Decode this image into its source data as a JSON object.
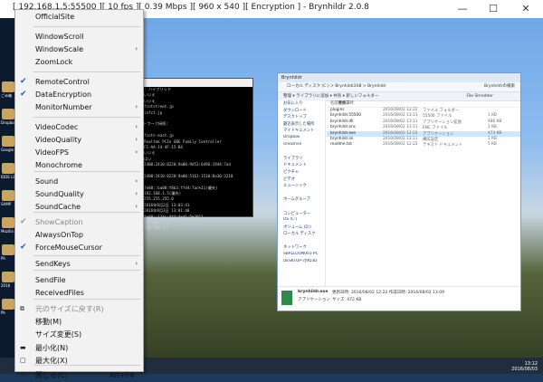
{
  "window": {
    "title": "[ 192.168.1.5:55500 ][ 10 fps ][ 0.39 Mbps ][ 960 x 540 ][ Encryption ] - Brynhildr 2.0.8",
    "minimize_glyph": "—",
    "maximize_glyph": "☐",
    "close_glyph": "✕"
  },
  "menu": {
    "items": [
      {
        "label": "OfficialSite"
      },
      {
        "label": "WindowScroll"
      },
      {
        "label": "WindowScale",
        "submenu": true
      },
      {
        "label": "ZoomLock"
      },
      {
        "label": "RemoteControl",
        "checked": true
      },
      {
        "label": "DataEncryption",
        "checked": true
      },
      {
        "label": "MonitorNumber",
        "submenu": true
      },
      {
        "label": "VideoCodec",
        "submenu": true
      },
      {
        "label": "VideoQuality",
        "submenu": true
      },
      {
        "label": "VideoFPS",
        "submenu": true
      },
      {
        "label": "Monochrome"
      },
      {
        "label": "Sound",
        "submenu": true
      },
      {
        "label": "SoundQuality",
        "submenu": true
      },
      {
        "label": "SoundCache",
        "submenu": true
      },
      {
        "label": "ShowCaption",
        "checked": true,
        "disabled": true
      },
      {
        "label": "AlwaysOnTop"
      },
      {
        "label": "ForceMouseCursor",
        "checked": true
      },
      {
        "label": "SendKeys",
        "submenu": true
      },
      {
        "label": "SendFile"
      },
      {
        "label": "ReceivedFiles"
      },
      {
        "label": "元のサイズに戻す(R)",
        "disabled": true,
        "icon": "restore-icon"
      },
      {
        "label": "移動(M)"
      },
      {
        "label": "サイズ変更(S)"
      },
      {
        "label": "最小化(N)",
        "icon": "minimize-icon"
      },
      {
        "label": "最大化(X)",
        "icon": "maximize-icon"
      },
      {
        "label": "閉じる(C)",
        "shortcut": "Alt+F4",
        "icon": "close-icon"
      }
    ],
    "arrow_glyph": "›",
    "check_glyph": "✔"
  },
  "remote": {
    "console_lines": [
      "   :  : ハイブリッド",
      "   : いいえ",
      "   : いいえ",
      "   : fintstreet.jp",
      "   : infct.jp",
      "",
      "ートワーク接続:",
      "",
      "   : fints-east.jp",
      "   : Realtek PCIe GBE Family Controller",
      "   : FC-AA-14-4F-15-B4",
      "   : いいえ",
      "   : はい",
      "   : 2400:2410:8220:9a00:9d51:6496:1944:7ad",
      "",
      "   : 2400:2410:8220:9a00:5161:1510:0a30:3210",
      "",
      "   : fe80::ba08:f8b3:ffd4:7ac%11(優先)",
      "   : 192.168.1.5(優先)",
      "   : 255.255.255.0",
      "   : 2016年8月2日 13:03:41",
      "   : 2016年8月3日 13:01:40",
      "   : fe80::124c:4ff:fe41:5%2011",
      "   : 192.168.1.1",
      "   : 192.168.1.1"
    ],
    "explorer": {
      "title": "Brynhildr",
      "address": "ローカル ディスク (C:) > Brynhildr208 > Brynhildr",
      "search": "Brynhildrの検索",
      "toolbar": "整理 ▾   ライブラリに追加 ▾   共有 ▾   新しいフォルダー",
      "toolbar_right": "File Shredder",
      "nav": [
        "お気に入り",
        "ダウンロード",
        "デスクトップ",
        "最近表示した場所",
        "マイドキュメント",
        "Dropbox",
        "OneDrive",
        "",
        "ライブラリ",
        "ドキュメント",
        "ピクチャ",
        "ビデオ",
        "ミュージック",
        "",
        "ホームグループ",
        "",
        "コンピューター",
        "OS (C:)",
        "ボリューム (D:)",
        "ローカル ディスク",
        "",
        "ネットワーク",
        "SBALLOON001-PC",
        "DESKTOP-7J9Q3D"
      ],
      "headers": [
        "名前",
        "更新日時",
        "種類",
        "サイズ"
      ],
      "rows": [
        {
          "name": "plugins",
          "date": "2016/08/02 12:22",
          "type": "ファイル フォルダー",
          "size": ""
        },
        {
          "name": "brynhildr.55500",
          "date": "2016/08/02 13:11",
          "type": "55500 ファイル",
          "size": "1 KB"
        },
        {
          "name": "brynhildr.dll",
          "date": "2016/08/02 13:11",
          "type": "アプリケーション拡張",
          "size": "486 KB"
        },
        {
          "name": "brynhildr.enc",
          "date": "2016/08/02 13:11",
          "type": "ENC ファイル",
          "size": "1 KB"
        },
        {
          "name": "brynhildr.exe",
          "date": "2016/08/02 12:22",
          "type": "アプリケーション",
          "size": "473 KB"
        },
        {
          "name": "brynhildr.ini",
          "date": "2016/08/02 13:11",
          "type": "構成設定",
          "size": "1 KB"
        },
        {
          "name": "readme.txt",
          "date": "2016/08/02 12:22",
          "type": "テキスト ドキュメント",
          "size": "5 KB"
        }
      ],
      "status_name": "brynhildr.exe",
      "status_line1": "更新日時: 2016/08/02 12:22    作成日時: 2016/08/02 13:09",
      "status_type": "アプリケーション",
      "status_size": "サイズ: 472 KB"
    },
    "clock": [
      "13:12",
      "2016/08/03"
    ],
    "desktop_labels": [
      "ごみ箱",
      "Dropbox",
      "Google",
      "IDDE Lib",
      "SAMP",
      "Mozilla",
      "Ph",
      "2016",
      "Ph"
    ]
  }
}
